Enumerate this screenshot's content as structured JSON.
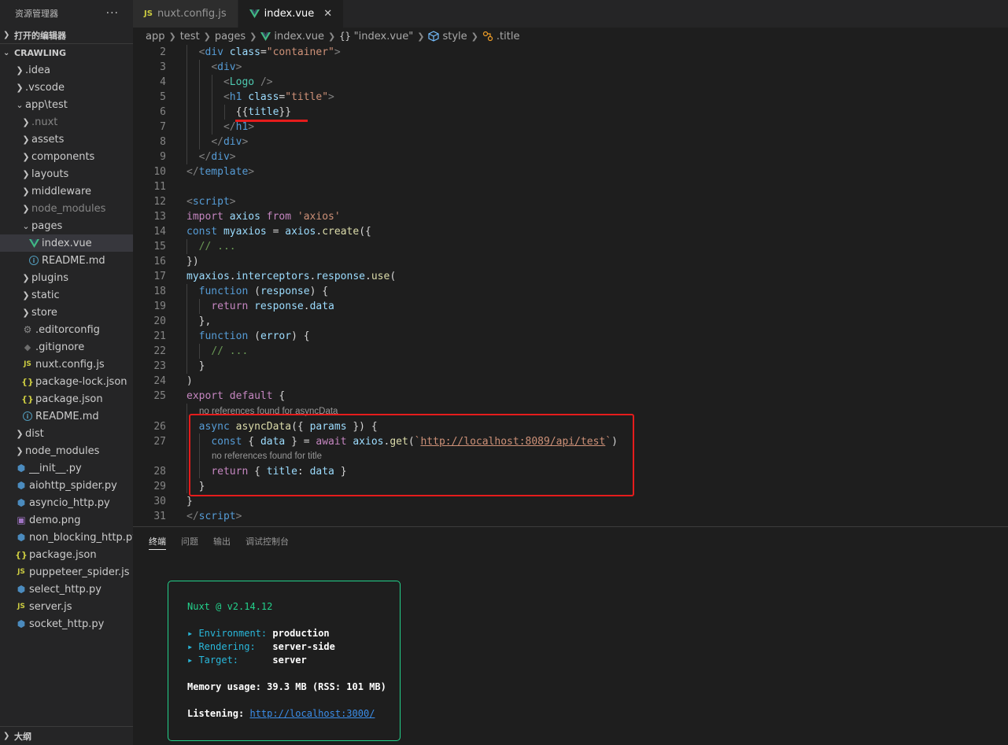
{
  "sidebar": {
    "title": "资源管理器",
    "more": "···",
    "open_editors": "打开的编辑器",
    "project": "CRAWLING",
    "outline": "大纲",
    "tree": [
      {
        "label": ".idea",
        "kind": "folder",
        "depth": 0
      },
      {
        "label": ".vscode",
        "kind": "folder",
        "depth": 0
      },
      {
        "label": "app\\test",
        "kind": "folder-open",
        "depth": 0
      },
      {
        "label": ".nuxt",
        "kind": "folder",
        "depth": 1,
        "dim": true
      },
      {
        "label": "assets",
        "kind": "folder",
        "depth": 1
      },
      {
        "label": "components",
        "kind": "folder",
        "depth": 1
      },
      {
        "label": "layouts",
        "kind": "folder",
        "depth": 1
      },
      {
        "label": "middleware",
        "kind": "folder",
        "depth": 1
      },
      {
        "label": "node_modules",
        "kind": "folder",
        "depth": 1,
        "dim": true
      },
      {
        "label": "pages",
        "kind": "folder-open",
        "depth": 1
      },
      {
        "label": "index.vue",
        "kind": "vue",
        "depth": 2,
        "selected": true
      },
      {
        "label": "README.md",
        "kind": "info",
        "depth": 2
      },
      {
        "label": "plugins",
        "kind": "folder",
        "depth": 1
      },
      {
        "label": "static",
        "kind": "folder",
        "depth": 1
      },
      {
        "label": "store",
        "kind": "folder",
        "depth": 1
      },
      {
        "label": ".editorconfig",
        "kind": "gear",
        "depth": 1
      },
      {
        "label": ".gitignore",
        "kind": "git",
        "depth": 1
      },
      {
        "label": "nuxt.config.js",
        "kind": "js",
        "depth": 1
      },
      {
        "label": "package-lock.json",
        "kind": "json",
        "depth": 1
      },
      {
        "label": "package.json",
        "kind": "json",
        "depth": 1
      },
      {
        "label": "README.md",
        "kind": "info",
        "depth": 1
      },
      {
        "label": "dist",
        "kind": "folder",
        "depth": 0
      },
      {
        "label": "node_modules",
        "kind": "folder",
        "depth": 0
      },
      {
        "label": "__init__.py",
        "kind": "py",
        "depth": 0
      },
      {
        "label": "aiohttp_spider.py",
        "kind": "py",
        "depth": 0
      },
      {
        "label": "asyncio_http.py",
        "kind": "py",
        "depth": 0
      },
      {
        "label": "demo.png",
        "kind": "img",
        "depth": 0
      },
      {
        "label": "non_blocking_http.py",
        "kind": "py",
        "depth": 0
      },
      {
        "label": "package.json",
        "kind": "json",
        "depth": 0
      },
      {
        "label": "puppeteer_spider.js",
        "kind": "js",
        "depth": 0
      },
      {
        "label": "select_http.py",
        "kind": "py",
        "depth": 0
      },
      {
        "label": "server.js",
        "kind": "js",
        "depth": 0
      },
      {
        "label": "socket_http.py",
        "kind": "py",
        "depth": 0
      }
    ]
  },
  "tabs": [
    {
      "label": "nuxt.config.js",
      "kind": "js",
      "active": false
    },
    {
      "label": "index.vue",
      "kind": "vue",
      "active": true,
      "close": "✕"
    }
  ],
  "breadcrumb": {
    "app": "app",
    "test": "test",
    "pages": "pages",
    "file": "index.vue",
    "object": "\"index.vue\"",
    "style": "style",
    "title": ".title"
  },
  "editor": {
    "lens_async": "no references found for asyncData",
    "lens_title": "no references found for title",
    "url": "http://localhost:8089/api/test"
  },
  "panel": {
    "tabs": [
      "终端",
      "问题",
      "输出",
      "调试控制台"
    ],
    "terminal": {
      "header": "Nuxt @ v2.14.12",
      "env_label": "▸ Environment:",
      "env_value": "production",
      "render_label": "▸ Rendering:",
      "render_value": "server-side",
      "target_label": "▸ Target:",
      "target_value": "server",
      "memory": "Memory usage: 39.3 MB (RSS: 101 MB)",
      "listen_label": "Listening:",
      "listen_url": "http://localhost:3000/"
    }
  },
  "colors": {
    "accent_border": "#23d18b",
    "highlight_red": "#e51c1c"
  }
}
